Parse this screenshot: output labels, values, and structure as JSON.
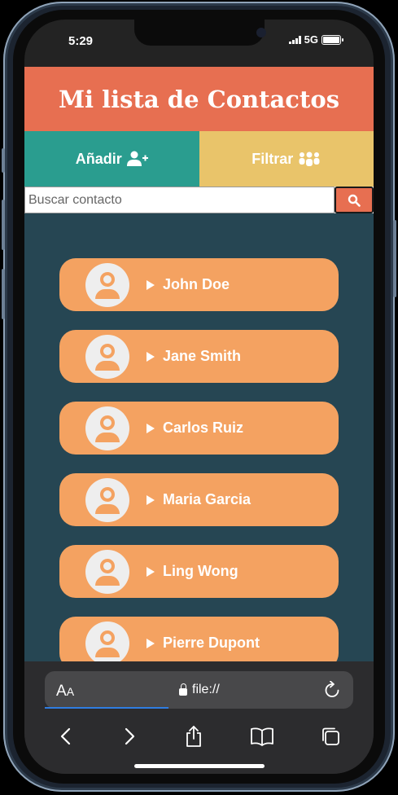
{
  "status": {
    "time": "5:29",
    "network": "5G"
  },
  "header": {
    "title": "Mi lista de Contactos"
  },
  "actions": {
    "add_label": "Añadir",
    "filter_label": "Filtrar"
  },
  "search": {
    "placeholder": "Buscar contacto",
    "value": ""
  },
  "contacts": [
    {
      "name": "John Doe"
    },
    {
      "name": "Jane Smith"
    },
    {
      "name": "Carlos Ruiz"
    },
    {
      "name": "Maria Garcia"
    },
    {
      "name": "Ling Wong"
    },
    {
      "name": "Pierre Dupont"
    }
  ],
  "browser": {
    "text_size_label": "A",
    "text_size_small": "A",
    "url": "file://"
  },
  "colors": {
    "header": "#e76f51",
    "add": "#2a9d8f",
    "filter": "#e9c46a",
    "background": "#264653",
    "card": "#f4a261"
  }
}
